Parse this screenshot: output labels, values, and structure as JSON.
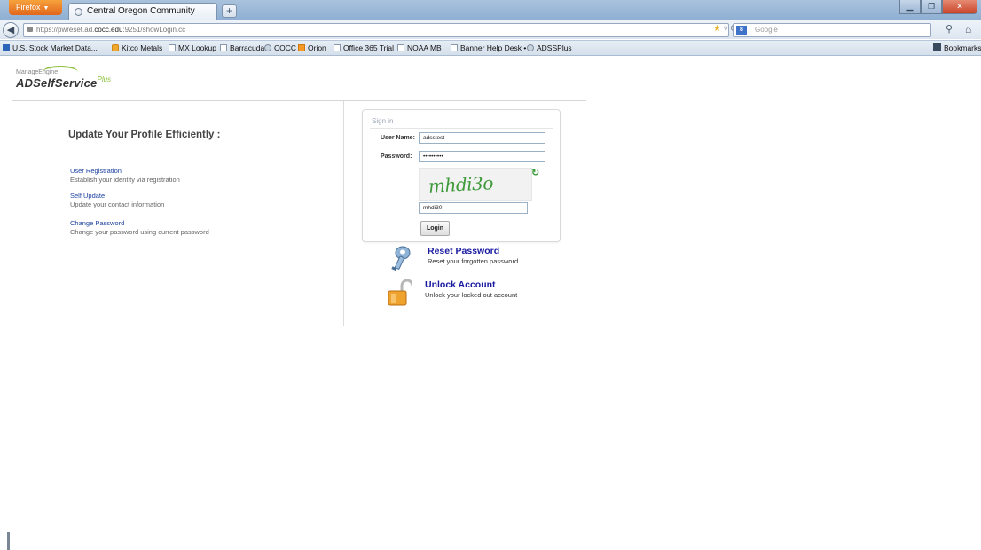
{
  "browser": {
    "app_button": "Firefox",
    "tab_title": "Central Oregon Community College",
    "new_tab": "+",
    "url_prefix": "https://pwreset.ad.",
    "url_domain": "cocc.edu",
    "url_suffix": ":9251/showLogin.cc",
    "search_engine_label": "8",
    "search_placeholder": "Google",
    "bookmarks": [
      {
        "label": "U.S. Stock Market Data...",
        "icon": "chart-icon"
      },
      {
        "label": "Kitco Metals",
        "icon": "coin-icon"
      },
      {
        "label": "MX Lookup",
        "icon": "page-icon"
      },
      {
        "label": "Barracuda",
        "icon": "page-icon"
      },
      {
        "label": "COCC",
        "icon": "globe-icon"
      },
      {
        "label": "Orion",
        "icon": "orion-icon"
      },
      {
        "label": "Office 365 Trial",
        "icon": "page-icon"
      },
      {
        "label": "NOAA MB",
        "icon": "page-icon"
      },
      {
        "label": "Banner Help Desk •",
        "icon": "page-icon"
      },
      {
        "label": "ADSSPlus",
        "icon": "globe-icon"
      }
    ],
    "bookmarks_menu": "Bookmarks"
  },
  "logo": {
    "vendor": "ManageEngine",
    "product": "ADSelfService",
    "plus": "Plus"
  },
  "left": {
    "title": "Update Your Profile Efficiently :",
    "features": [
      {
        "link": "User Registration",
        "desc": "Establish your identity via registration"
      },
      {
        "link": "Self Update",
        "desc": "Update your contact information"
      },
      {
        "link": "Change Password",
        "desc": "Change your password using current password"
      }
    ]
  },
  "signin": {
    "title": "Sign in",
    "username_label": "User Name:",
    "username_value": "adsstest",
    "password_label": "Password:",
    "password_value": "••••••••••",
    "captcha_text": "mhdi3o",
    "captcha_value": "mhdi30",
    "login_button": "Login"
  },
  "actions": [
    {
      "title": "Reset Password",
      "desc": "Reset your forgotten password",
      "icon": "key-icon"
    },
    {
      "title": "Unlock Account",
      "desc": "Unlock your locked out account",
      "icon": "padlock-icon"
    }
  ],
  "colors": {
    "link": "#1b3f9e",
    "action_title": "#1a1aa0",
    "captcha": "#3f9a3a"
  }
}
